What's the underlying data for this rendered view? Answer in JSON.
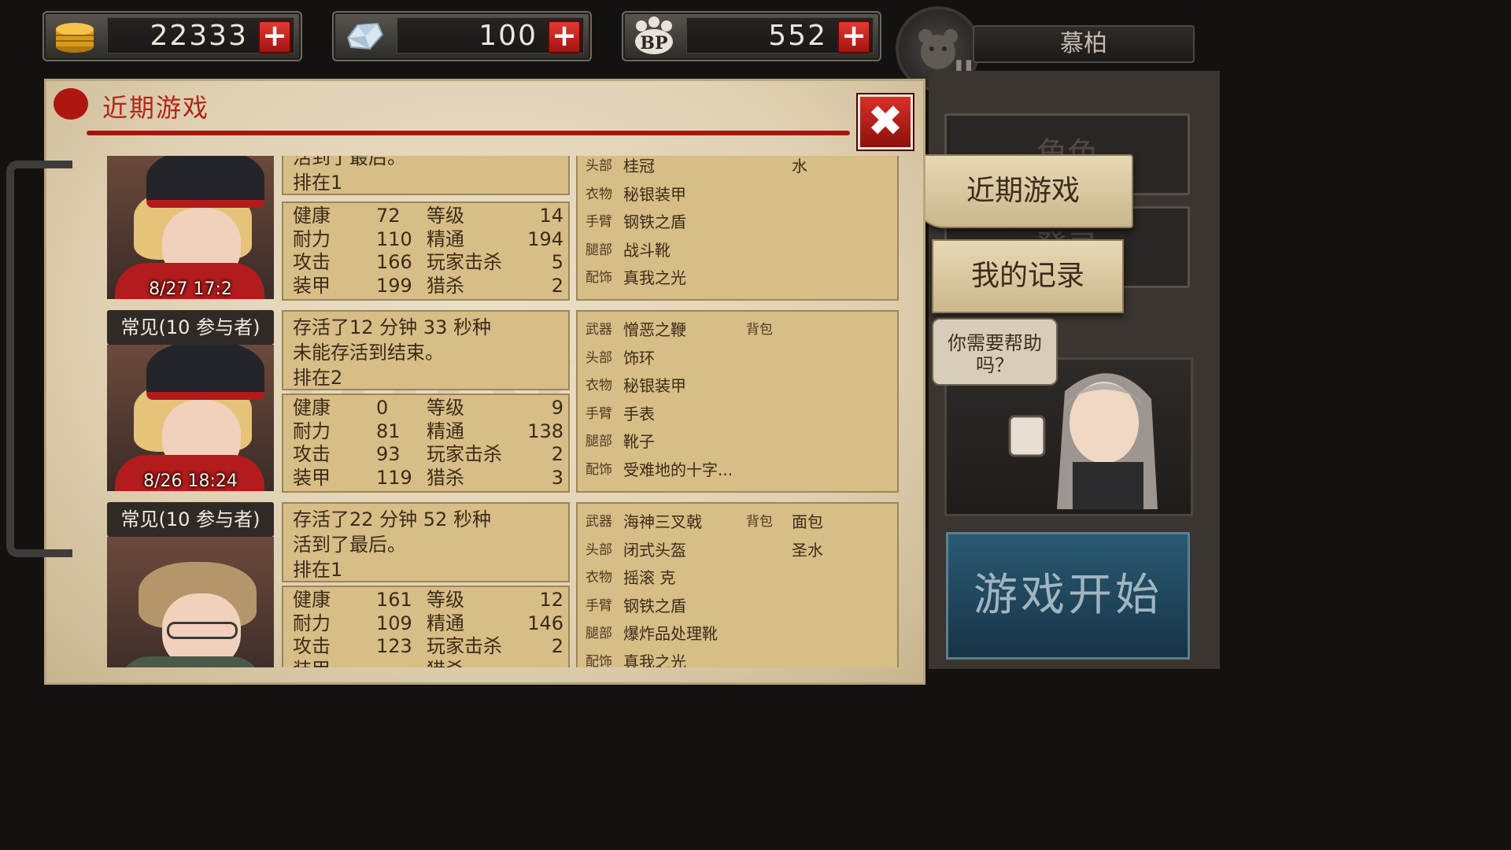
{
  "resources": {
    "gold": "22333",
    "diamond": "100",
    "bp_icon": "BP",
    "bp": "552"
  },
  "player": {
    "name": "慕柏",
    "rank": "II"
  },
  "panel": {
    "title": "近期游戏",
    "close_symbol": "✖"
  },
  "menu": {
    "bg_slot_1": "角色",
    "bg_slot_2": "登录",
    "tab_active": "近期游戏",
    "tab_records": "我的记录",
    "help_text_1": "你需要帮助",
    "help_text_2": "吗？",
    "start_button": "游戏开始"
  },
  "games": [
    {
      "mode": "",
      "date": "8/27 17:2",
      "summary": [
        "活到了最后。",
        "排在1"
      ],
      "stats": {
        "health_label": "健康",
        "health": "72",
        "level_label": "等级",
        "level": "14",
        "stamina_label": "耐力",
        "stamina": "110",
        "mastery_label": "精通",
        "mastery": "194",
        "attack_label": "攻击",
        "attack": "166",
        "pk_label": "玩家击杀",
        "pk": "5",
        "armor_label": "装甲",
        "armor": "199",
        "hunt_label": "猎杀",
        "hunt": "2"
      },
      "equipment": [
        {
          "slot": "头部",
          "item": "桂冠",
          "bag_label": "",
          "bag_item": "水"
        },
        {
          "slot": "衣物",
          "item": "秘银装甲",
          "bag_label": "",
          "bag_item": ""
        },
        {
          "slot": "手臂",
          "item": "钢铁之盾",
          "bag_label": "",
          "bag_item": ""
        },
        {
          "slot": "腿部",
          "item": "战斗靴",
          "bag_label": "",
          "bag_item": ""
        },
        {
          "slot": "配饰",
          "item": "真我之光",
          "bag_label": "",
          "bag_item": ""
        }
      ]
    },
    {
      "mode": "常见(10  参与者)",
      "date": "8/26 18:24",
      "summary": [
        "存活了12  分钟  33  秒种",
        "未能存活到结束。",
        "排在2"
      ],
      "stats": {
        "health_label": "健康",
        "health": "0",
        "level_label": "等级",
        "level": "9",
        "stamina_label": "耐力",
        "stamina": "81",
        "mastery_label": "精通",
        "mastery": "138",
        "attack_label": "攻击",
        "attack": "93",
        "pk_label": "玩家击杀",
        "pk": "2",
        "armor_label": "装甲",
        "armor": "119",
        "hunt_label": "猎杀",
        "hunt": "3"
      },
      "equipment": [
        {
          "slot": "武器",
          "item": "憎恶之鞭",
          "bag_label": "背包",
          "bag_item": ""
        },
        {
          "slot": "头部",
          "item": "饰环",
          "bag_label": "",
          "bag_item": ""
        },
        {
          "slot": "衣物",
          "item": "秘银装甲",
          "bag_label": "",
          "bag_item": ""
        },
        {
          "slot": "手臂",
          "item": "手表",
          "bag_label": "",
          "bag_item": ""
        },
        {
          "slot": "腿部",
          "item": "靴子",
          "bag_label": "",
          "bag_item": ""
        },
        {
          "slot": "配饰",
          "item": "受难地的十字...",
          "bag_label": "",
          "bag_item": ""
        }
      ]
    },
    {
      "mode": "常见(10  参与者)",
      "date": "",
      "summary": [
        "存活了22  分钟  52  秒种",
        "活到了最后。",
        "排在1"
      ],
      "stats": {
        "health_label": "健康",
        "health": "161",
        "level_label": "等级",
        "level": "12",
        "stamina_label": "耐力",
        "stamina": "109",
        "mastery_label": "精通",
        "mastery": "146",
        "attack_label": "攻击",
        "attack": "123",
        "pk_label": "玩家击杀",
        "pk": "2",
        "armor_label": "装甲",
        "armor": "",
        "hunt_label": "猎杀",
        "hunt": ""
      },
      "equipment": [
        {
          "slot": "武器",
          "item": "海神三叉戟",
          "bag_label": "背包",
          "bag_item": "面包"
        },
        {
          "slot": "头部",
          "item": "闭式头盔",
          "bag_label": "",
          "bag_item": "圣水"
        },
        {
          "slot": "衣物",
          "item": "摇滚  克",
          "bag_label": "",
          "bag_item": ""
        },
        {
          "slot": "手臂",
          "item": "钢铁之盾",
          "bag_label": "",
          "bag_item": ""
        },
        {
          "slot": "腿部",
          "item": "爆炸品处理靴",
          "bag_label": "",
          "bag_item": ""
        },
        {
          "slot": "配饰",
          "item": "真我之光",
          "bag_label": "",
          "bag_item": ""
        }
      ]
    }
  ]
}
